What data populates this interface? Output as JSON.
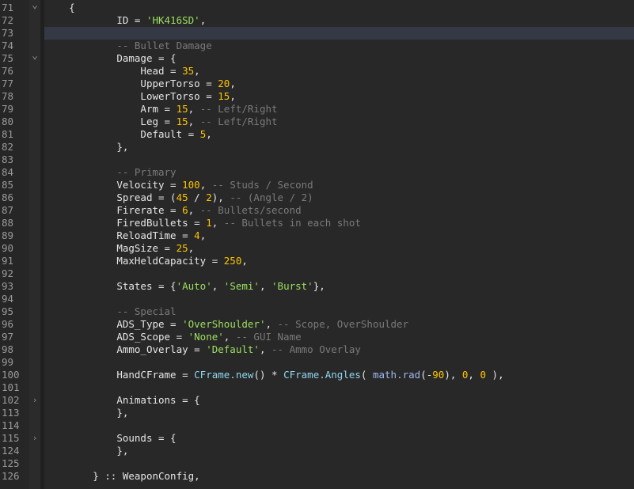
{
  "editor": {
    "indent_width": 8,
    "active_line": "73",
    "colors": {
      "background": "#282828",
      "gutter": "#262626",
      "active_line": "#353945",
      "string": "#9be05f",
      "number": "#ffc600",
      "comment": "#7a7a7a",
      "function": "#8fd6ef",
      "builtin": "#9fb8ee"
    },
    "lines": [
      {
        "n": "71",
        "fold": "chevron-down",
        "indent": 4,
        "tokens": [
          {
            "t": "{",
            "c": "pl"
          }
        ]
      },
      {
        "n": "72",
        "indent": 12,
        "tokens": [
          {
            "t": "ID = ",
            "c": "pl"
          },
          {
            "t": "'HK416SD'",
            "c": "str"
          },
          {
            "t": ",",
            "c": "pl"
          }
        ]
      },
      {
        "n": "73",
        "indent": 0,
        "tokens": []
      },
      {
        "n": "74",
        "indent": 12,
        "tokens": [
          {
            "t": "-- Bullet Damage",
            "c": "com"
          }
        ]
      },
      {
        "n": "75",
        "fold": "chevron-down",
        "indent": 12,
        "tokens": [
          {
            "t": "Damage = {",
            "c": "pl"
          }
        ]
      },
      {
        "n": "76",
        "indent": 16,
        "tokens": [
          {
            "t": "Head = ",
            "c": "pl"
          },
          {
            "t": "35",
            "c": "num"
          },
          {
            "t": ",",
            "c": "pl"
          }
        ]
      },
      {
        "n": "77",
        "indent": 16,
        "tokens": [
          {
            "t": "UpperTorso = ",
            "c": "pl"
          },
          {
            "t": "20",
            "c": "num"
          },
          {
            "t": ",",
            "c": "pl"
          }
        ]
      },
      {
        "n": "78",
        "indent": 16,
        "tokens": [
          {
            "t": "LowerTorso = ",
            "c": "pl"
          },
          {
            "t": "15",
            "c": "num"
          },
          {
            "t": ",",
            "c": "pl"
          }
        ]
      },
      {
        "n": "79",
        "indent": 16,
        "tokens": [
          {
            "t": "Arm = ",
            "c": "pl"
          },
          {
            "t": "15",
            "c": "num"
          },
          {
            "t": ", ",
            "c": "pl"
          },
          {
            "t": "-- Left/Right",
            "c": "com"
          }
        ]
      },
      {
        "n": "80",
        "indent": 16,
        "tokens": [
          {
            "t": "Leg = ",
            "c": "pl"
          },
          {
            "t": "15",
            "c": "num"
          },
          {
            "t": ", ",
            "c": "pl"
          },
          {
            "t": "-- Left/Right",
            "c": "com"
          }
        ]
      },
      {
        "n": "81",
        "indent": 16,
        "tokens": [
          {
            "t": "Default = ",
            "c": "pl"
          },
          {
            "t": "5",
            "c": "num"
          },
          {
            "t": ",",
            "c": "pl"
          }
        ]
      },
      {
        "n": "82",
        "indent": 12,
        "tokens": [
          {
            "t": "},",
            "c": "pl"
          }
        ]
      },
      {
        "n": "83",
        "indent": 0,
        "tokens": []
      },
      {
        "n": "84",
        "indent": 12,
        "tokens": [
          {
            "t": "-- Primary",
            "c": "com"
          }
        ]
      },
      {
        "n": "85",
        "indent": 12,
        "tokens": [
          {
            "t": "Velocity = ",
            "c": "pl"
          },
          {
            "t": "100",
            "c": "num"
          },
          {
            "t": ", ",
            "c": "pl"
          },
          {
            "t": "-- Studs / Second",
            "c": "com"
          }
        ]
      },
      {
        "n": "86",
        "indent": 12,
        "tokens": [
          {
            "t": "Spread = (",
            "c": "pl"
          },
          {
            "t": "45",
            "c": "num"
          },
          {
            "t": " / ",
            "c": "pl"
          },
          {
            "t": "2",
            "c": "num"
          },
          {
            "t": "), ",
            "c": "pl"
          },
          {
            "t": "-- (Angle / 2)",
            "c": "com"
          }
        ]
      },
      {
        "n": "87",
        "indent": 12,
        "tokens": [
          {
            "t": "Firerate = ",
            "c": "pl"
          },
          {
            "t": "6",
            "c": "num"
          },
          {
            "t": ", ",
            "c": "pl"
          },
          {
            "t": "-- Bullets/second",
            "c": "com"
          }
        ]
      },
      {
        "n": "88",
        "indent": 12,
        "tokens": [
          {
            "t": "FiredBullets = ",
            "c": "pl"
          },
          {
            "t": "1",
            "c": "num"
          },
          {
            "t": ", ",
            "c": "pl"
          },
          {
            "t": "-- Bullets in each shot",
            "c": "com"
          }
        ]
      },
      {
        "n": "89",
        "indent": 12,
        "tokens": [
          {
            "t": "ReloadTime = ",
            "c": "pl"
          },
          {
            "t": "4",
            "c": "num"
          },
          {
            "t": ",",
            "c": "pl"
          }
        ]
      },
      {
        "n": "90",
        "indent": 12,
        "tokens": [
          {
            "t": "MagSize = ",
            "c": "pl"
          },
          {
            "t": "25",
            "c": "num"
          },
          {
            "t": ",",
            "c": "pl"
          }
        ]
      },
      {
        "n": "91",
        "indent": 12,
        "tokens": [
          {
            "t": "MaxHeldCapacity = ",
            "c": "pl"
          },
          {
            "t": "250",
            "c": "num"
          },
          {
            "t": ",",
            "c": "pl"
          }
        ]
      },
      {
        "n": "92",
        "indent": 0,
        "tokens": []
      },
      {
        "n": "93",
        "indent": 12,
        "tokens": [
          {
            "t": "States = {",
            "c": "pl"
          },
          {
            "t": "'Auto'",
            "c": "str"
          },
          {
            "t": ", ",
            "c": "pl"
          },
          {
            "t": "'Semi'",
            "c": "str"
          },
          {
            "t": ", ",
            "c": "pl"
          },
          {
            "t": "'Burst'",
            "c": "str"
          },
          {
            "t": "},",
            "c": "pl"
          }
        ]
      },
      {
        "n": "94",
        "indent": 0,
        "tokens": []
      },
      {
        "n": "95",
        "indent": 12,
        "tokens": [
          {
            "t": "-- Special",
            "c": "com"
          }
        ]
      },
      {
        "n": "96",
        "indent": 12,
        "tokens": [
          {
            "t": "ADS_Type = ",
            "c": "pl"
          },
          {
            "t": "'OverShoulder'",
            "c": "str"
          },
          {
            "t": ", ",
            "c": "pl"
          },
          {
            "t": "-- Scope, OverShoulder",
            "c": "com"
          }
        ]
      },
      {
        "n": "97",
        "indent": 12,
        "tokens": [
          {
            "t": "ADS_Scope = ",
            "c": "pl"
          },
          {
            "t": "'None'",
            "c": "str"
          },
          {
            "t": ", ",
            "c": "pl"
          },
          {
            "t": "-- GUI Name",
            "c": "com"
          }
        ]
      },
      {
        "n": "98",
        "indent": 12,
        "tokens": [
          {
            "t": "Ammo_Overlay = ",
            "c": "pl"
          },
          {
            "t": "'Default'",
            "c": "str"
          },
          {
            "t": ", ",
            "c": "pl"
          },
          {
            "t": "-- Ammo Overlay",
            "c": "com"
          }
        ]
      },
      {
        "n": "99",
        "indent": 0,
        "tokens": []
      },
      {
        "n": "100",
        "indent": 12,
        "tokens": [
          {
            "t": "HandCFrame = ",
            "c": "pl"
          },
          {
            "t": "CFrame.new",
            "c": "fn"
          },
          {
            "t": "() * ",
            "c": "pl"
          },
          {
            "t": "CFrame.Angles",
            "c": "fn"
          },
          {
            "t": "( ",
            "c": "pl"
          },
          {
            "t": "math.rad",
            "c": "bl"
          },
          {
            "t": "(-",
            "c": "pl"
          },
          {
            "t": "90",
            "c": "num"
          },
          {
            "t": "), ",
            "c": "pl"
          },
          {
            "t": "0",
            "c": "num"
          },
          {
            "t": ", ",
            "c": "pl"
          },
          {
            "t": "0",
            "c": "num"
          },
          {
            "t": " ),",
            "c": "pl"
          }
        ]
      },
      {
        "n": "101",
        "indent": 0,
        "tokens": []
      },
      {
        "n": "102",
        "fold": "chevron-right",
        "indent": 12,
        "tokens": [
          {
            "t": "Animations = {",
            "c": "pl"
          }
        ]
      },
      {
        "n": "113",
        "indent": 12,
        "tokens": [
          {
            "t": "},",
            "c": "pl"
          }
        ]
      },
      {
        "n": "114",
        "indent": 0,
        "tokens": []
      },
      {
        "n": "115",
        "fold": "chevron-right",
        "indent": 12,
        "tokens": [
          {
            "t": "Sounds = {",
            "c": "pl"
          }
        ]
      },
      {
        "n": "124",
        "indent": 12,
        "tokens": [
          {
            "t": "},",
            "c": "pl"
          }
        ]
      },
      {
        "n": "125",
        "indent": 0,
        "tokens": []
      },
      {
        "n": "126",
        "indent": 8,
        "tokens": [
          {
            "t": "} :: WeaponConfig,",
            "c": "pl"
          }
        ]
      }
    ]
  }
}
